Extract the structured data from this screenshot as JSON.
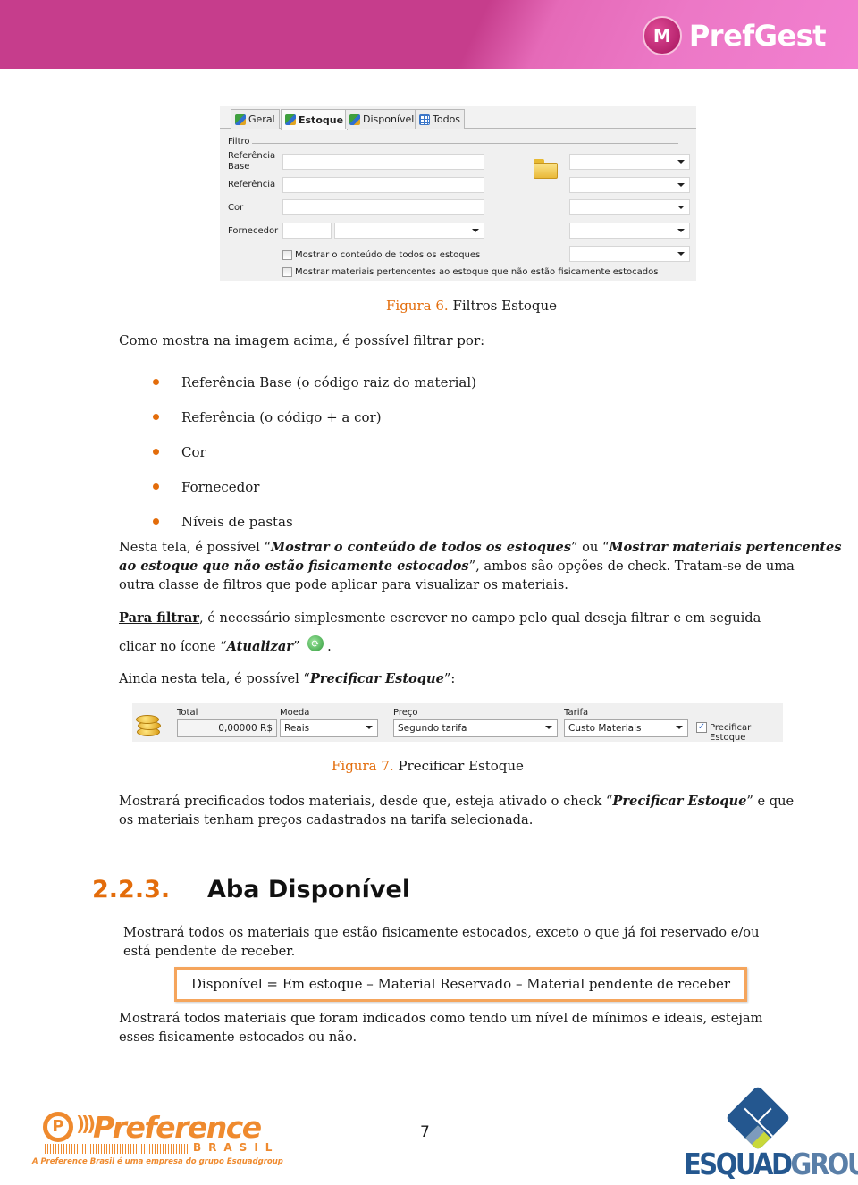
{
  "header": {
    "product_name": "PrefGest",
    "brand_color": "#c63d8c"
  },
  "figure6": {
    "tabs": [
      {
        "label": "Geral",
        "icon": "cubes-icon",
        "active": false
      },
      {
        "label": "Estoque",
        "icon": "cubes-icon",
        "active": true
      },
      {
        "label": "Disponível",
        "icon": "cubes-icon",
        "active": false
      },
      {
        "label": "Todos",
        "icon": "grid-icon",
        "active": false
      }
    ],
    "group_label": "Filtro",
    "fields": {
      "referencia_base": {
        "label": "Referência Base",
        "value": ""
      },
      "referencia": {
        "label": "Referência",
        "value": ""
      },
      "cor": {
        "label": "Cor",
        "value": ""
      },
      "fornecedor": {
        "label": "Fornecedor",
        "code_value": "",
        "select_value": ""
      }
    },
    "folder_selects": [
      "",
      "",
      "",
      "",
      ""
    ],
    "checkboxes": [
      {
        "label": "Mostrar o conteúdo de todos os estoques",
        "checked": false
      },
      {
        "label": "Mostrar materiais pertencentes ao estoque que não estão fisicamente estocados",
        "checked": false
      }
    ],
    "caption_prefix": "Figura 6.",
    "caption_text": " Filtros Estoque"
  },
  "body": {
    "intro": "Como mostra na imagem acima, é possível filtrar por:",
    "bullets": [
      "Referência Base (o código raiz do material)",
      "Referência (o código + a cor)",
      "Cor",
      "Fornecedor",
      "Níveis de pastas"
    ],
    "para1": {
      "t1": "Nesta tela, é possível “",
      "e1": "Mostrar o conteúdo de todos os estoques",
      "t2": "” ou “",
      "e2": "Mostrar materiais pertencentes",
      "e3": "ao estoque que não estão fisicamente estocados",
      "t3": "”, ambos são opções de check. Tratam-se de uma",
      "line3": "outra classe de filtros que pode aplicar para visualizar os materiais."
    },
    "para2": {
      "link": "Para filtrar",
      "t1": ", é necessário simplesmente escrever no campo pelo qual deseja filtrar e em seguida",
      "t2": "clicar no ícone “",
      "e1": "Atualizar",
      "t3": "”",
      "t4": "."
    },
    "para3": {
      "t1": "Ainda nesta tela, é possível “",
      "e1": "Precificar Estoque",
      "t2": "”:"
    }
  },
  "figure7": {
    "total_label": "Total",
    "total_value": "0,00000 R$",
    "moeda_label": "Moeda",
    "moeda_value": "Reais",
    "preco_label": "Preço",
    "preco_value": "Segundo tarifa",
    "tarifa_label": "Tarifa",
    "tarifa_value": "Custo Materiais",
    "checkbox_label": "Precificar Estoque",
    "checkbox_checked": true,
    "caption_prefix": "Figura 7.",
    "caption_text": " Precificar Estoque"
  },
  "para4": {
    "t1": "Mostrará precificados todos materiais, desde que, esteja ativado o check “",
    "e1": "Precificar Estoque",
    "t2": "” e que",
    "line2": "os materiais tenham preços cadastrados na tarifa selecionada."
  },
  "section": {
    "number": "2.2.3.",
    "title": "Aba Disponível",
    "para1_line1": "Mostrará todos os materiais que estão fisicamente estocados, exceto o que já foi reservado e/ou",
    "para1_line2": "está pendente de receber.",
    "formula": "Disponível = Em estoque – Material Reservado – Material pendente de receber",
    "para2_line1": "Mostrará todos materiais que foram indicados como tendo um nível de mínimos e ideais, estejam",
    "para2_line2": "esses fisicamente estocados ou não."
  },
  "footer": {
    "page_number": "7",
    "pref_logo_word": "Preference",
    "pref_logo_sub": "BRASIL",
    "pref_logo_tagline": "A Preference Brasil é uma empresa do grupo Esquadgroup",
    "esq_logo_a": "ESQUAD",
    "esq_logo_b": "GROUP",
    "accent_color": "#e36c0a"
  }
}
